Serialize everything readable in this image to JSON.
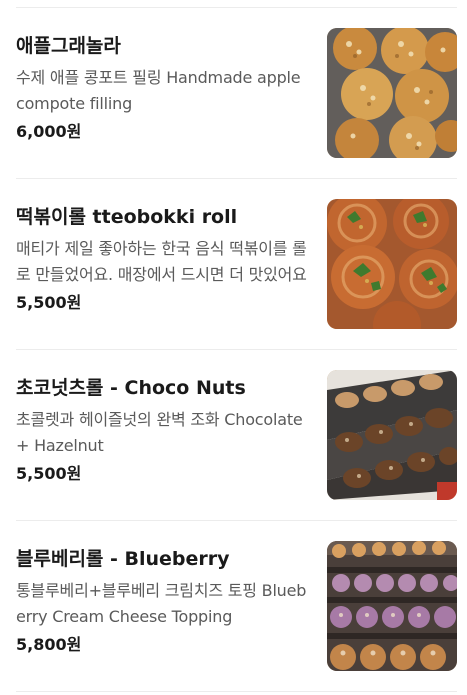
{
  "menu": {
    "items": [
      {
        "name": "애플그래놀라",
        "description": "수제 애플 콩포트 필링 Handmade apple compote filling",
        "price": "6,000원",
        "thumbnail_icon": "apple-granola-photo"
      },
      {
        "name": "떡볶이롤 tteobokki roll",
        "description": "매티가 제일 좋아하는 한국 음식 떡볶이를 롤로 만들었어요. 매장에서 드시면 더 맛있어요",
        "price": "5,500원",
        "thumbnail_icon": "tteobokki-roll-photo"
      },
      {
        "name": "초코넛츠롤 - Choco Nuts",
        "description": "초콜렛과 헤이즐넛의 완벽 조화 Chocolate + Hazelnut",
        "price": "5,500원",
        "thumbnail_icon": "choco-nuts-roll-photo"
      },
      {
        "name": "블루베리롤 - Blueberry",
        "description": "통블루베리+블루베리 크림치즈 토핑 Blueberry Cream Cheese Topping",
        "price": "5,800원",
        "thumbnail_icon": "blueberry-roll-photo"
      }
    ]
  }
}
